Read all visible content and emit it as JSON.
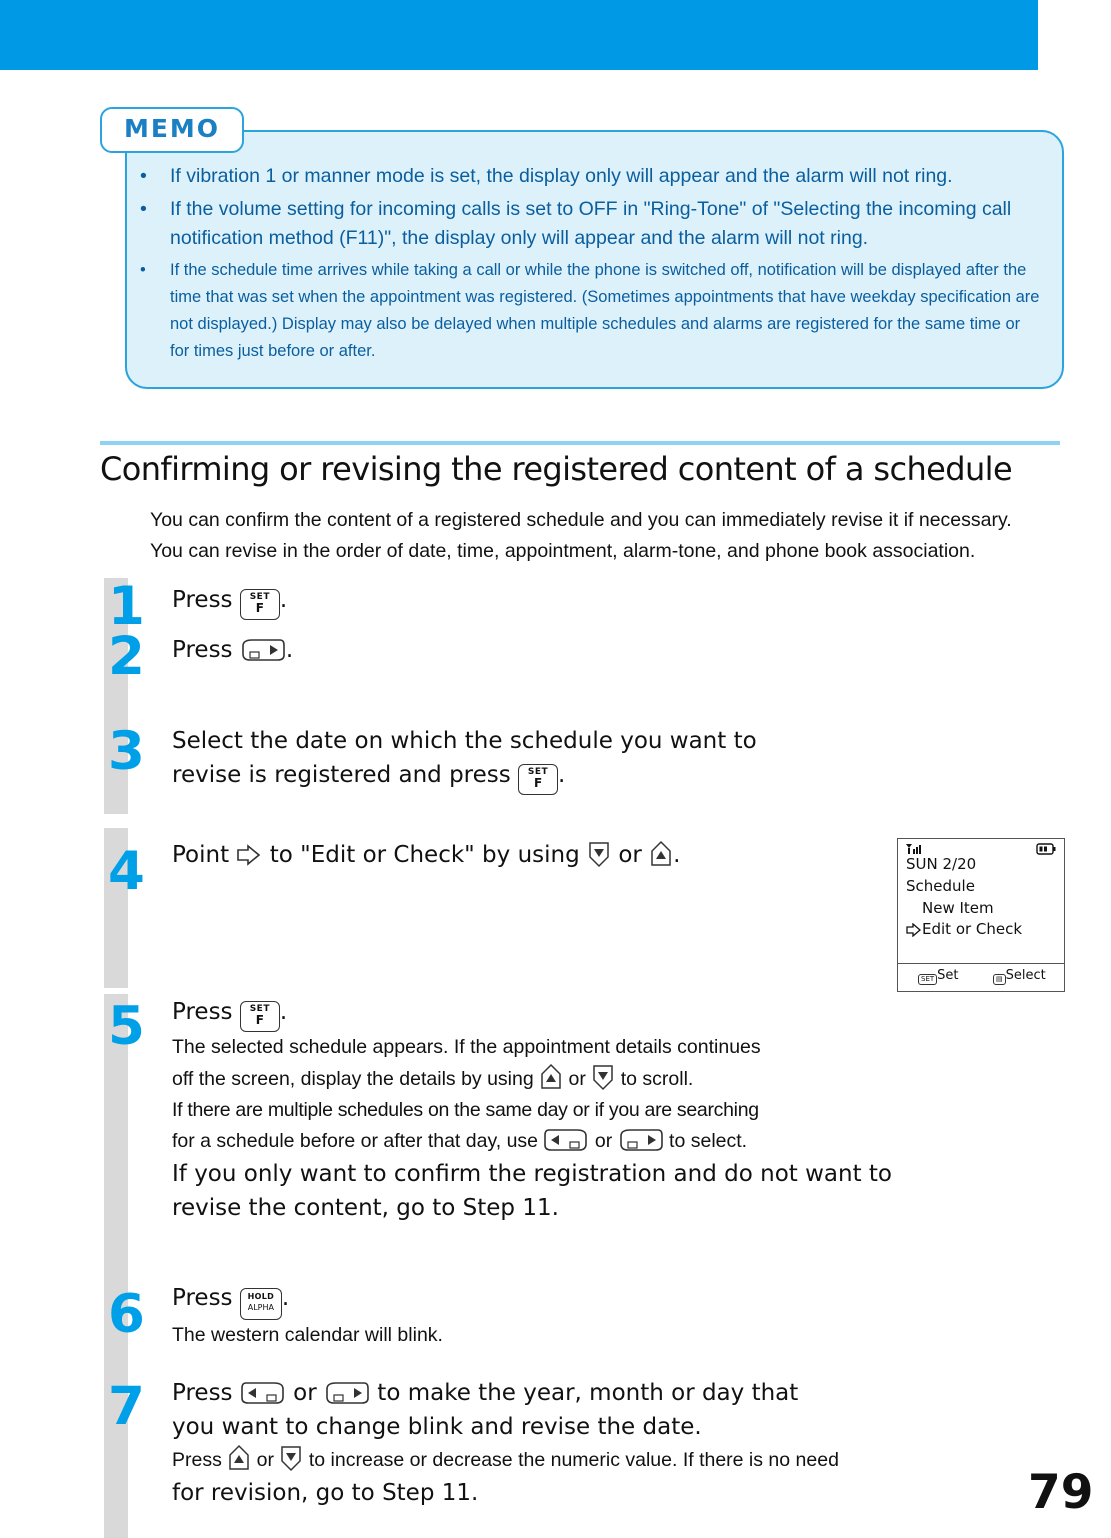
{
  "memo": {
    "label": "MEMO",
    "items": [
      {
        "text": "If vibration 1 or manner mode is set, the display only will appear and the alarm will not ring.",
        "size": "large"
      },
      {
        "text": "If the volume setting for incoming calls is set to OFF in \"Ring-Tone\" of \"Selecting the incoming call notification method (F11)\", the display only will appear and the alarm will not ring.",
        "size": "large"
      },
      {
        "text": "If the schedule time arrives while taking a call or while the phone is switched off, notification will be displayed after the time that was set when the appointment was registered. (Sometimes appointments that have weekday specification are not displayed.) Display may also be delayed when multiple schedules and alarms are registered for the same time or for times just before or after.",
        "size": "small"
      }
    ]
  },
  "section": {
    "title": "Confirming or revising the registered content of a schedule",
    "intro_line1": "You can confirm the content of a registered schedule and you can immediately revise it if necessary.",
    "intro_line2": "You can revise in the order of date, time, appointment, alarm-tone, and phone book association."
  },
  "steps": [
    {
      "number": "1",
      "lines": [
        "Press ",
        "."
      ]
    },
    {
      "number": "2",
      "lines": [
        "Press ",
        "."
      ]
    },
    {
      "number": "3",
      "line1": "Select the date on which the schedule you want to",
      "line2a": "revise is registered and press ",
      "line2b": "."
    },
    {
      "number": "4",
      "a": "Point ",
      "b": " to \"Edit or Check\" by using ",
      "c": " or ",
      "d": "."
    },
    {
      "number": "5",
      "main_a": "Press ",
      "main_b": ".",
      "sub1": "The selected schedule appears. If the appointment details continues",
      "sub2a": "off the screen, display the details by using ",
      "sub2b": " or ",
      "sub2c": " to scroll.",
      "sub3": "If there are multiple schedules on the same day or if you are searching",
      "sub4a": "for a schedule before or after that day, use ",
      "sub4b": " or ",
      "sub4c": " to select.",
      "sub5": "If you only want to confirm the registration and do not want to",
      "sub6": "revise the content, go to Step 11."
    },
    {
      "number": "6",
      "main_a": "Press ",
      "main_b": ".",
      "sub1": "The western calendar will blink."
    },
    {
      "number": "7",
      "main_a": "Press ",
      "main_b": " or ",
      "main_c": " to make the year, month or day that",
      "line2": "you want to change blink and revise the date.",
      "sub_a": "Press ",
      "sub_b": " or ",
      "sub_c": " to increase or decrease the numeric value. If there is no need",
      "sub2": "for revision, go to Step 11."
    }
  ],
  "phone_screen": {
    "date": "SUN 2/20",
    "title": "Schedule",
    "item1": "New Item",
    "item2": "Edit or Check",
    "softleft": "Set",
    "softright": "Select",
    "softleft_key": "SET",
    "softright_key": "▤"
  },
  "page_number": "79",
  "colors": {
    "header_blue": "#0099e5",
    "memo_fill": "#ddf1fb",
    "memo_border": "#2ba3dd",
    "step_number": "#00a0e9",
    "rail": "#d9d9d9",
    "rule": "#8fd3f4"
  }
}
